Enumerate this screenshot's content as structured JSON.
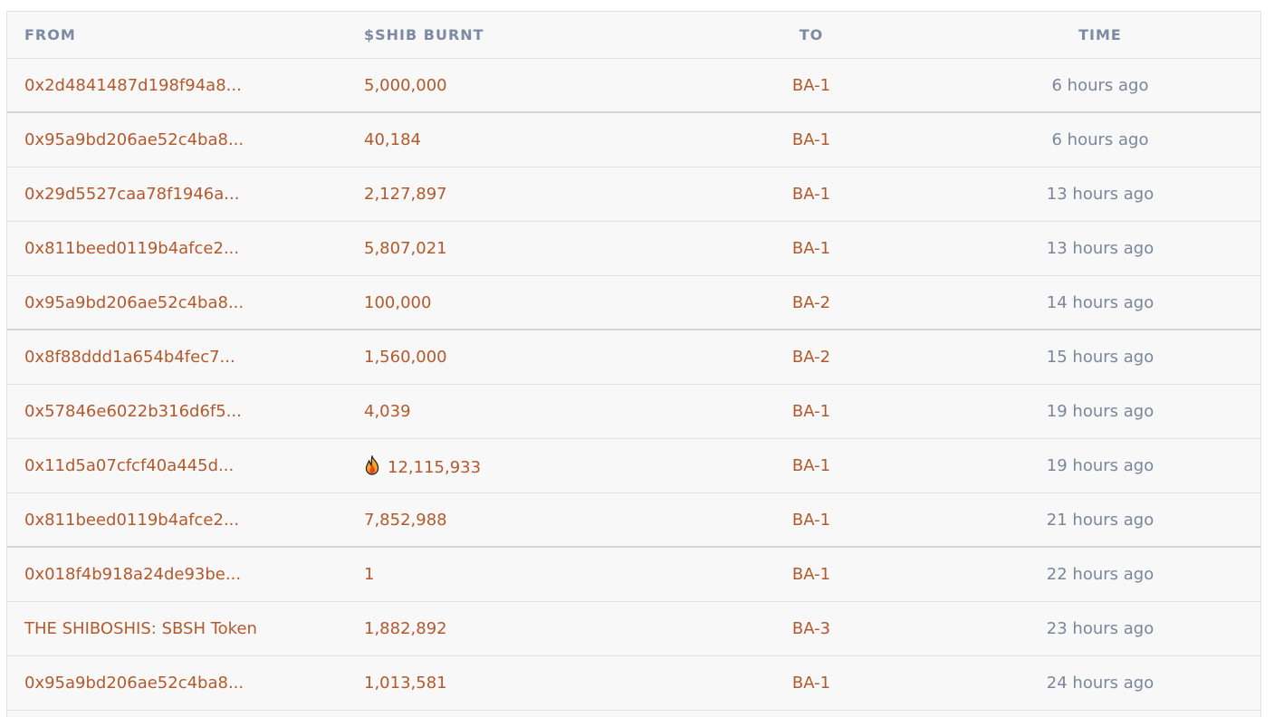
{
  "columns": {
    "from": "FROM",
    "burnt": "$SHIB BURNT",
    "to": "TO",
    "time": "TIME"
  },
  "rows": [
    {
      "from": "0x2d4841487d198f94a8...",
      "burnt": "5,000,000",
      "to": "BA-1",
      "time": "6 hours ago"
    },
    {
      "from": "0x95a9bd206ae52c4ba8...",
      "burnt": "40,184",
      "to": "BA-1",
      "time": "6 hours ago"
    },
    {
      "from": "0x29d5527caa78f1946a...",
      "burnt": "2,127,897",
      "to": "BA-1",
      "time": "13 hours ago"
    },
    {
      "from": "0x811beed0119b4afce2...",
      "burnt": "5,807,021",
      "to": "BA-1",
      "time": "13 hours ago"
    },
    {
      "from": "0x95a9bd206ae52c4ba8...",
      "burnt": "100,000",
      "to": "BA-2",
      "time": "14 hours ago"
    },
    {
      "from": "0x8f88ddd1a654b4fec7...",
      "burnt": "1,560,000",
      "to": "BA-2",
      "time": "15 hours ago"
    },
    {
      "from": "0x57846e6022b316d6f5...",
      "burnt": "4,039",
      "to": "BA-1",
      "time": "19 hours ago"
    },
    {
      "from": "0x11d5a07cfcf40a445d...",
      "burnt": "12,115,933",
      "to": "BA-1",
      "time": "19 hours ago",
      "flame": true
    },
    {
      "from": "0x811beed0119b4afce2...",
      "burnt": "7,852,988",
      "to": "BA-1",
      "time": "21 hours ago"
    },
    {
      "from": "0x018f4b918a24de93be...",
      "burnt": "1",
      "to": "BA-1",
      "time": "22 hours ago"
    },
    {
      "from": "THE SHIBOSHIS: SBSH Token",
      "burnt": "1,882,892",
      "to": "BA-3",
      "time": "23 hours ago"
    },
    {
      "from": "0x95a9bd206ae52c4ba8...",
      "burnt": "1,013,581",
      "to": "BA-1",
      "time": "24 hours ago"
    }
  ],
  "icons": {
    "flame": "flame-icon"
  },
  "colors": {
    "link": "#b4592b",
    "muted": "#7a8699",
    "header": "#7e8aa1"
  }
}
